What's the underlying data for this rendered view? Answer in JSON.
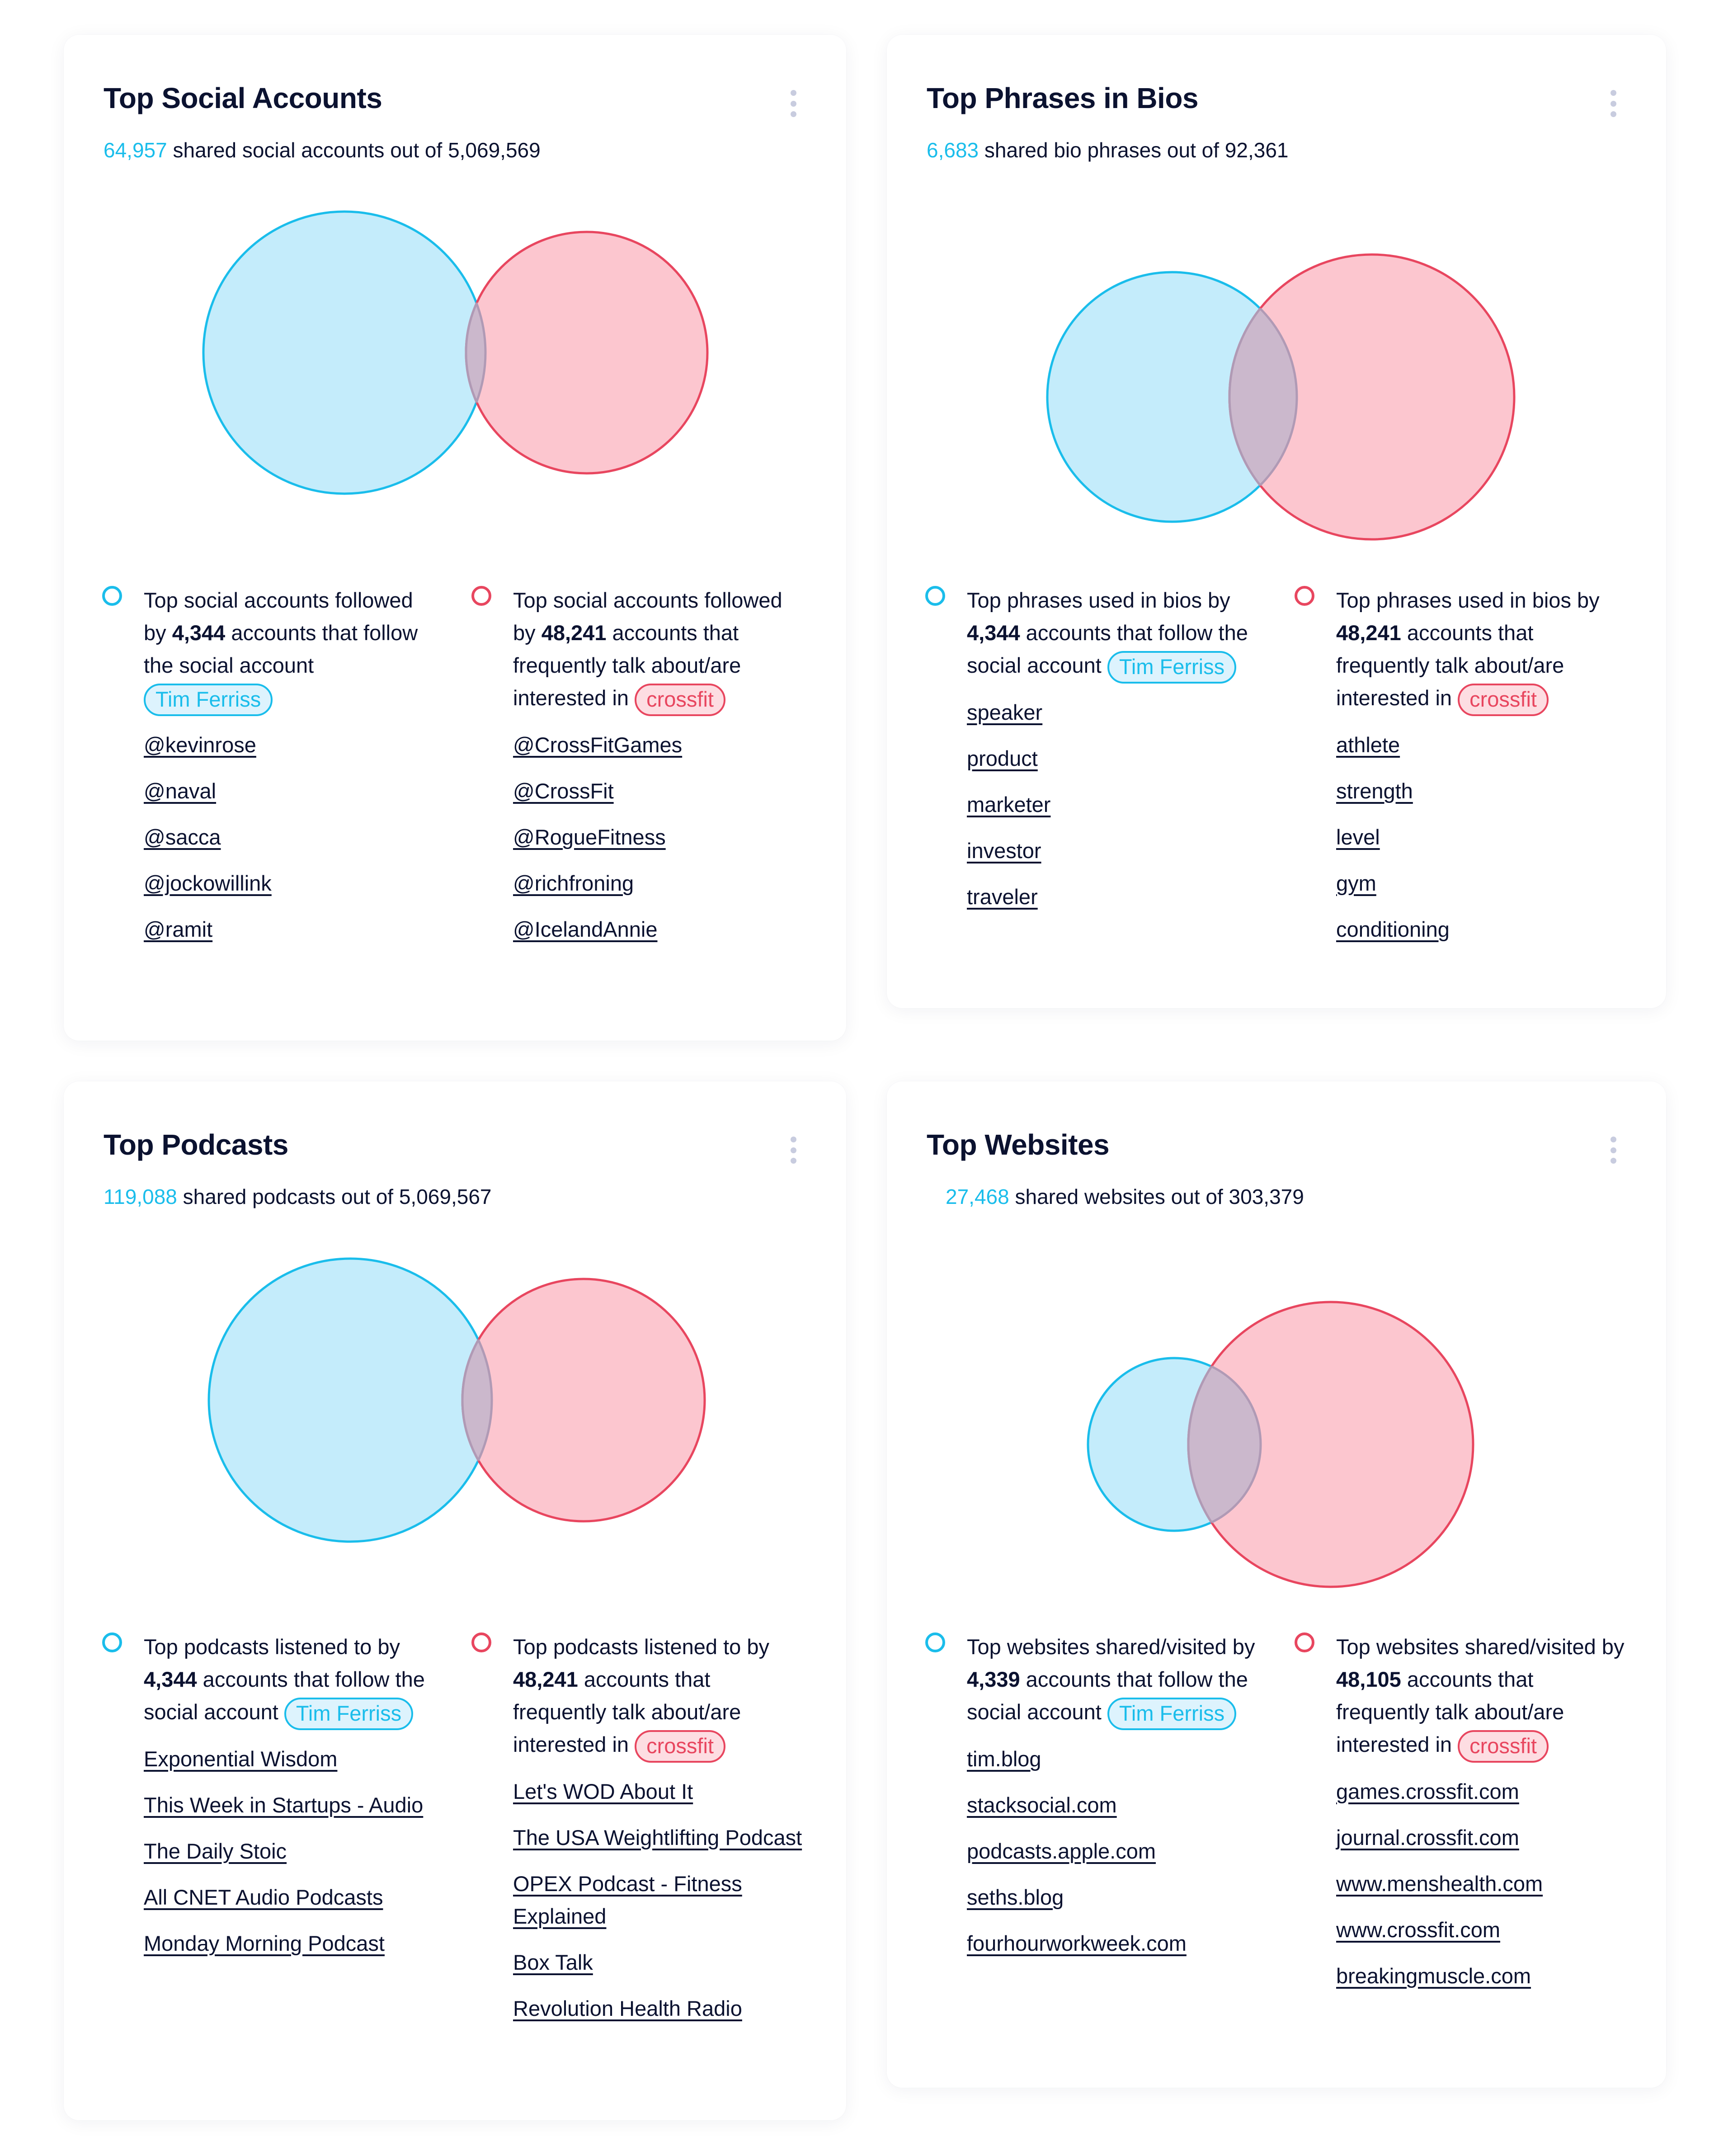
{
  "colors": {
    "accent_blue": "#1ABDEB",
    "accent_red": "#E8465F",
    "blue_fill": "#C4ECFB",
    "red_fill": "#FCC6CF",
    "overlap_fill": "#CBB8CC",
    "overlap_stroke": "#B09AB5",
    "text": "#0B1230",
    "menu_dots": "#C8CCDF"
  },
  "cards": [
    {
      "title": "Top Social Accounts",
      "subtitle_count": "64,957",
      "subtitle_text": " shared social accounts out of 5,069,569",
      "menu_icon": "kebab-vertical-icon",
      "left": {
        "prefix": "Top social accounts followed by ",
        "count": "4,344",
        "suffix": " accounts that follow the social account ",
        "pill": "Tim Ferriss",
        "items": [
          "@kevinrose",
          "@naval",
          "@sacca",
          "@jockowillink",
          "@ramit"
        ]
      },
      "right": {
        "prefix": "Top social accounts followed by ",
        "count": "48,241",
        "suffix": " accounts that frequently talk about/are interested in ",
        "pill": "crossfit",
        "items": [
          "@CrossFitGames",
          "@CrossFit",
          "@RogueFitness",
          "@richfroning",
          "@IcelandAnnie"
        ]
      }
    },
    {
      "title": "Top Phrases in Bios",
      "subtitle_count": "6,683",
      "subtitle_text": " shared bio phrases out of 92,361",
      "menu_icon": "kebab-vertical-icon",
      "left": {
        "prefix": "Top phrases used in bios by ",
        "count": "4,344",
        "suffix": " accounts that follow the social account ",
        "pill": "Tim Ferriss",
        "items": [
          "speaker",
          "product",
          "marketer",
          "investor",
          "traveler"
        ]
      },
      "right": {
        "prefix": "Top phrases used in bios by ",
        "count": "48,241",
        "suffix": " accounts that frequently talk about/are interested in ",
        "pill": "crossfit",
        "items": [
          "athlete",
          "strength",
          "level",
          "gym",
          "conditioning"
        ]
      }
    },
    {
      "title": "Top Podcasts",
      "subtitle_count": "119,088",
      "subtitle_text": " shared podcasts out of 5,069,567",
      "menu_icon": "kebab-vertical-icon",
      "left": {
        "prefix": "Top podcasts listened to by ",
        "count": "4,344",
        "suffix": " accounts that follow the social account ",
        "pill": "Tim Ferriss",
        "items": [
          "Exponential Wisdom",
          "This Week in Startups - Audio",
          "The Daily Stoic",
          "All CNET Audio Podcasts",
          "Monday Morning Podcast"
        ]
      },
      "right": {
        "prefix": "Top podcasts listened to by ",
        "count": "48,241",
        "suffix": " accounts that frequently talk about/are interested in ",
        "pill": "crossfit",
        "items": [
          "Let's WOD About It",
          "The USA Weightlifting Podcast",
          "OPEX Podcast - Fitness Explained",
          "Box Talk",
          "Revolution Health Radio"
        ]
      }
    },
    {
      "title": "Top Websites",
      "subtitle_count": "27,468",
      "subtitle_text": " shared websites out of 303,379",
      "menu_icon": "kebab-vertical-icon",
      "left": {
        "prefix": "Top websites shared/visited by ",
        "count": "4,339",
        "suffix": " accounts that follow the social account ",
        "pill": "Tim Ferriss",
        "items": [
          "tim.blog",
          "stacksocial.com",
          "podcasts.apple.com",
          "seths.blog",
          "fourhourworkweek.com"
        ]
      },
      "right": {
        "prefix": "Top websites shared/visited by ",
        "count": "48,105",
        "suffix": " accounts that frequently talk about/are interested in ",
        "pill": "crossfit",
        "items": [
          "games.crossfit.com",
          "journal.crossfit.com",
          "www.menshealth.com",
          "www.crossfit.com",
          "breakingmuscle.com"
        ]
      }
    }
  ]
}
